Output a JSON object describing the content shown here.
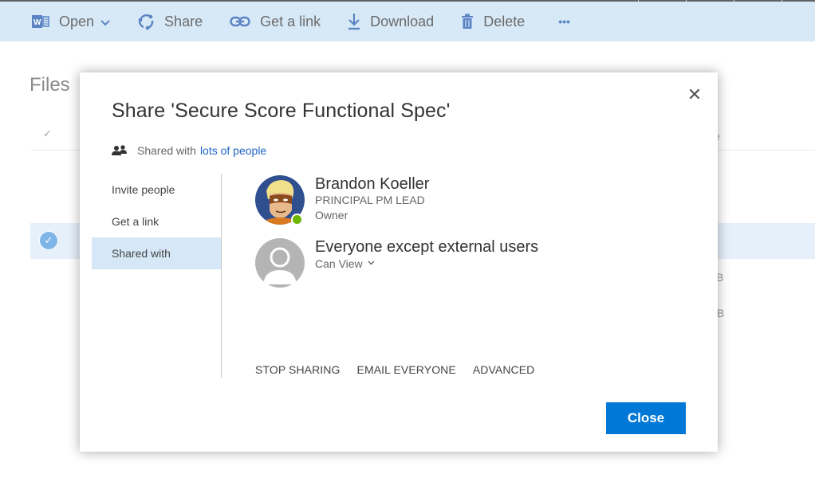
{
  "command_bar": {
    "items": [
      {
        "label": "Open",
        "icon": "word-doc-icon",
        "has_dropdown": true
      },
      {
        "label": "Share",
        "icon": "share-icon"
      },
      {
        "label": "Get a link",
        "icon": "link-icon"
      },
      {
        "label": "Download",
        "icon": "download-icon"
      },
      {
        "label": "Delete",
        "icon": "trash-icon"
      }
    ],
    "more_label": "•••"
  },
  "background": {
    "title": "Files",
    "header_check": "✓",
    "row_check": "✓",
    "fragments": [
      "e",
      "B",
      "B"
    ]
  },
  "dialog": {
    "title": "Share 'Secure Score Functional Spec'",
    "close_glyph": "✕",
    "shared_prefix": "Shared with",
    "shared_link": "lots of people",
    "nav": [
      {
        "label": "Invite people",
        "active": false
      },
      {
        "label": "Get a link",
        "active": false
      },
      {
        "label": "Shared with",
        "active": true
      }
    ],
    "people": [
      {
        "name": "Brandon Koeller",
        "title": "PRINCIPAL PM LEAD",
        "role": "Owner",
        "presence": "online"
      },
      {
        "name": "Everyone except external users",
        "permission": "Can View"
      }
    ],
    "actions": [
      "STOP SHARING",
      "EMAIL EVERYONE",
      "ADVANCED"
    ],
    "close_button": "Close"
  },
  "colors": {
    "accent": "#0078d7",
    "command_bar_bg": "#d7e9f7",
    "link": "#1e64c8",
    "presence_online": "#6bb700"
  }
}
